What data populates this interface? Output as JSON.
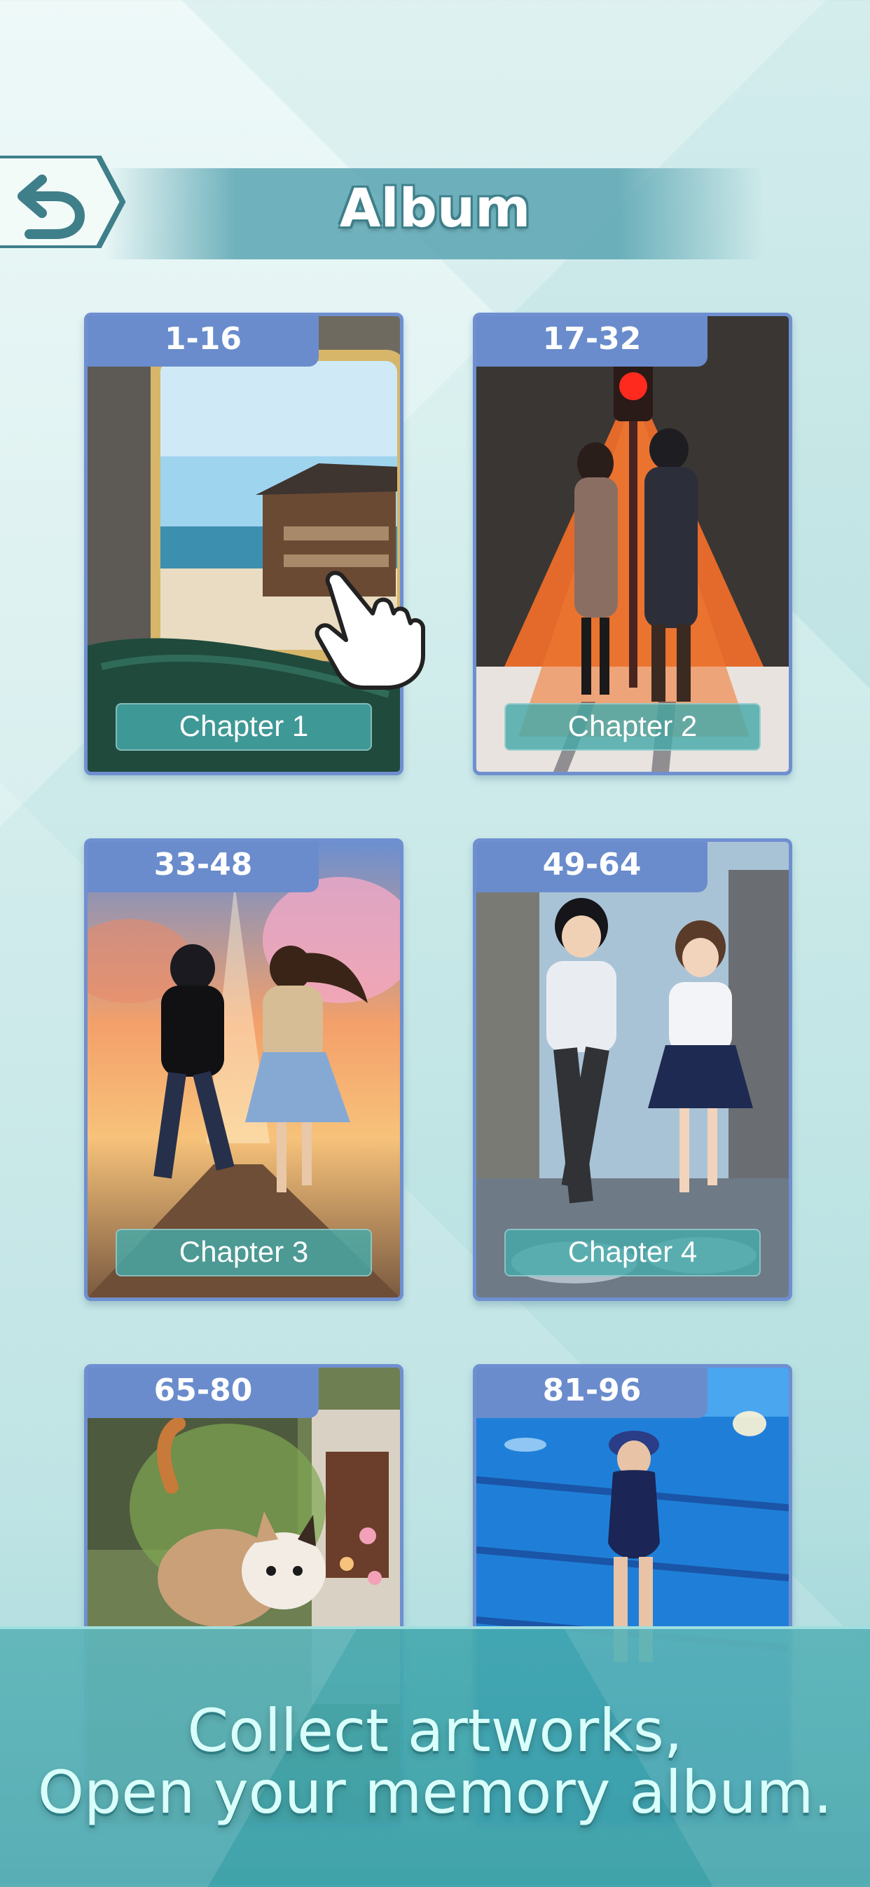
{
  "header": {
    "title": "Album",
    "back_icon": "back-arrow-icon"
  },
  "cards": [
    {
      "range": "1-16",
      "chapter": "Chapter 1",
      "art": "train-window-seaside-house"
    },
    {
      "range": "17-32",
      "chapter": "Chapter 2",
      "art": "couple-under-red-traffic-light-snow"
    },
    {
      "range": "33-48",
      "chapter": "Chapter 3",
      "art": "couple-running-toward-sunset"
    },
    {
      "range": "49-64",
      "chapter": "Chapter 4",
      "art": "students-running-in-rain"
    },
    {
      "range": "65-80",
      "chapter": "",
      "art": "cat-in-garden"
    },
    {
      "range": "81-96",
      "chapter": "",
      "art": "swimmer-at-pool"
    }
  ],
  "tutorial_hand_icon": "pointing-hand-icon",
  "banner": {
    "line1": "Collect artworks,",
    "line2": "Open your memory album."
  },
  "colors": {
    "tab": "#6a8ccc",
    "card_border": "#6f8fd1",
    "chapter_plate": "#46aaaa",
    "title_outline": "#3e7f8a",
    "banner": "#46aaaf"
  }
}
